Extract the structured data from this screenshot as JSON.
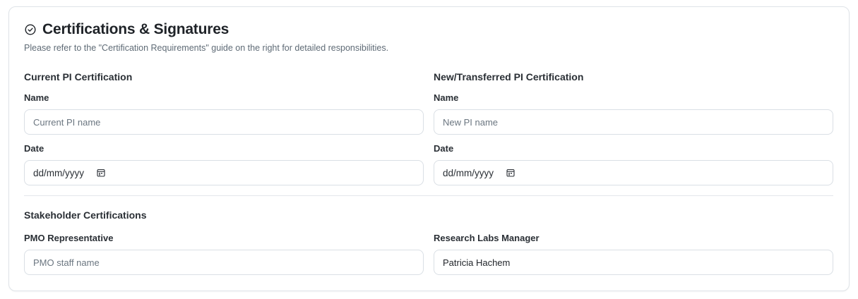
{
  "section": {
    "title": "Certifications & Signatures",
    "subtitle": "Please refer to the \"Certification Requirements\" guide on the right for detailed responsibilities.",
    "icon": "check-circle-icon"
  },
  "current_pi": {
    "heading": "Current PI Certification",
    "name_label": "Name",
    "name_placeholder": "Current PI name",
    "name_value": "",
    "date_label": "Date",
    "date_value": "dd/mm/yyyy",
    "date_icon": "calendar-icon"
  },
  "new_pi": {
    "heading": "New/Transferred PI Certification",
    "name_label": "Name",
    "name_placeholder": "New PI name",
    "name_value": "",
    "date_label": "Date",
    "date_value": "dd/mm/yyyy",
    "date_icon": "calendar-icon"
  },
  "stakeholders": {
    "heading": "Stakeholder Certifications",
    "pmo": {
      "label": "PMO Representative",
      "placeholder": "PMO staff name",
      "value": ""
    },
    "labs_manager": {
      "label": "Research Labs Manager",
      "placeholder": "",
      "value": "Patricia Hachem"
    }
  },
  "colors": {
    "border": "#dadfe5",
    "text": "#1f2328",
    "muted": "#5f6b76"
  }
}
